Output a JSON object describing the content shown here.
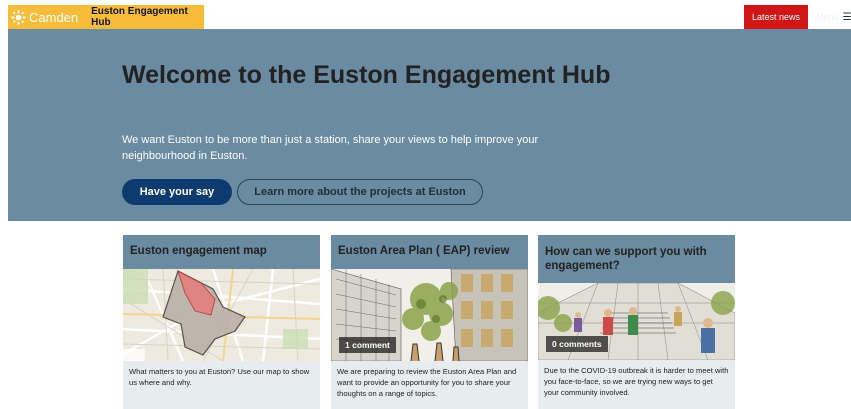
{
  "header": {
    "logo_text": "Camden",
    "hub_name": "Euston Engagement Hub",
    "latest_news": "Latest news",
    "menu": "Menu",
    "menu_icon": "hamburger-icon"
  },
  "hero": {
    "title": "Welcome to the Euston Engagement Hub",
    "subtitle": "We want Euston to be more than just a station, share your views to help improve your neighbourhood in Euston.",
    "primary_button": "Have your say",
    "secondary_button": "Learn more about the projects at Euston"
  },
  "cards": [
    {
      "title": "Euston engagement map",
      "text": "What matters to you at Euston? Use our map to show us where and why.",
      "image": "map-thumbnail"
    },
    {
      "title": "Euston Area Plan ( EAP) review",
      "comments": "1 comment",
      "text": "We are preparing to review the Euston Area Plan and want to provide an opportunity for you to share your thoughts on a range of topics.",
      "image": "street-sketch-thumbnail"
    },
    {
      "title": "How can we support you with engagement?",
      "comments": "0 comments",
      "text": "Due to the COVID-19 outbreak it is harder to meet with you face-to-face, so we are trying new ways to get your community involved.",
      "image": "station-sketch-thumbnail"
    }
  ],
  "colors": {
    "brand_yellow": "#f7bc3a",
    "hero_blue": "#6a8ba1",
    "primary_navy": "#0b3b6f",
    "news_red": "#d11616"
  }
}
